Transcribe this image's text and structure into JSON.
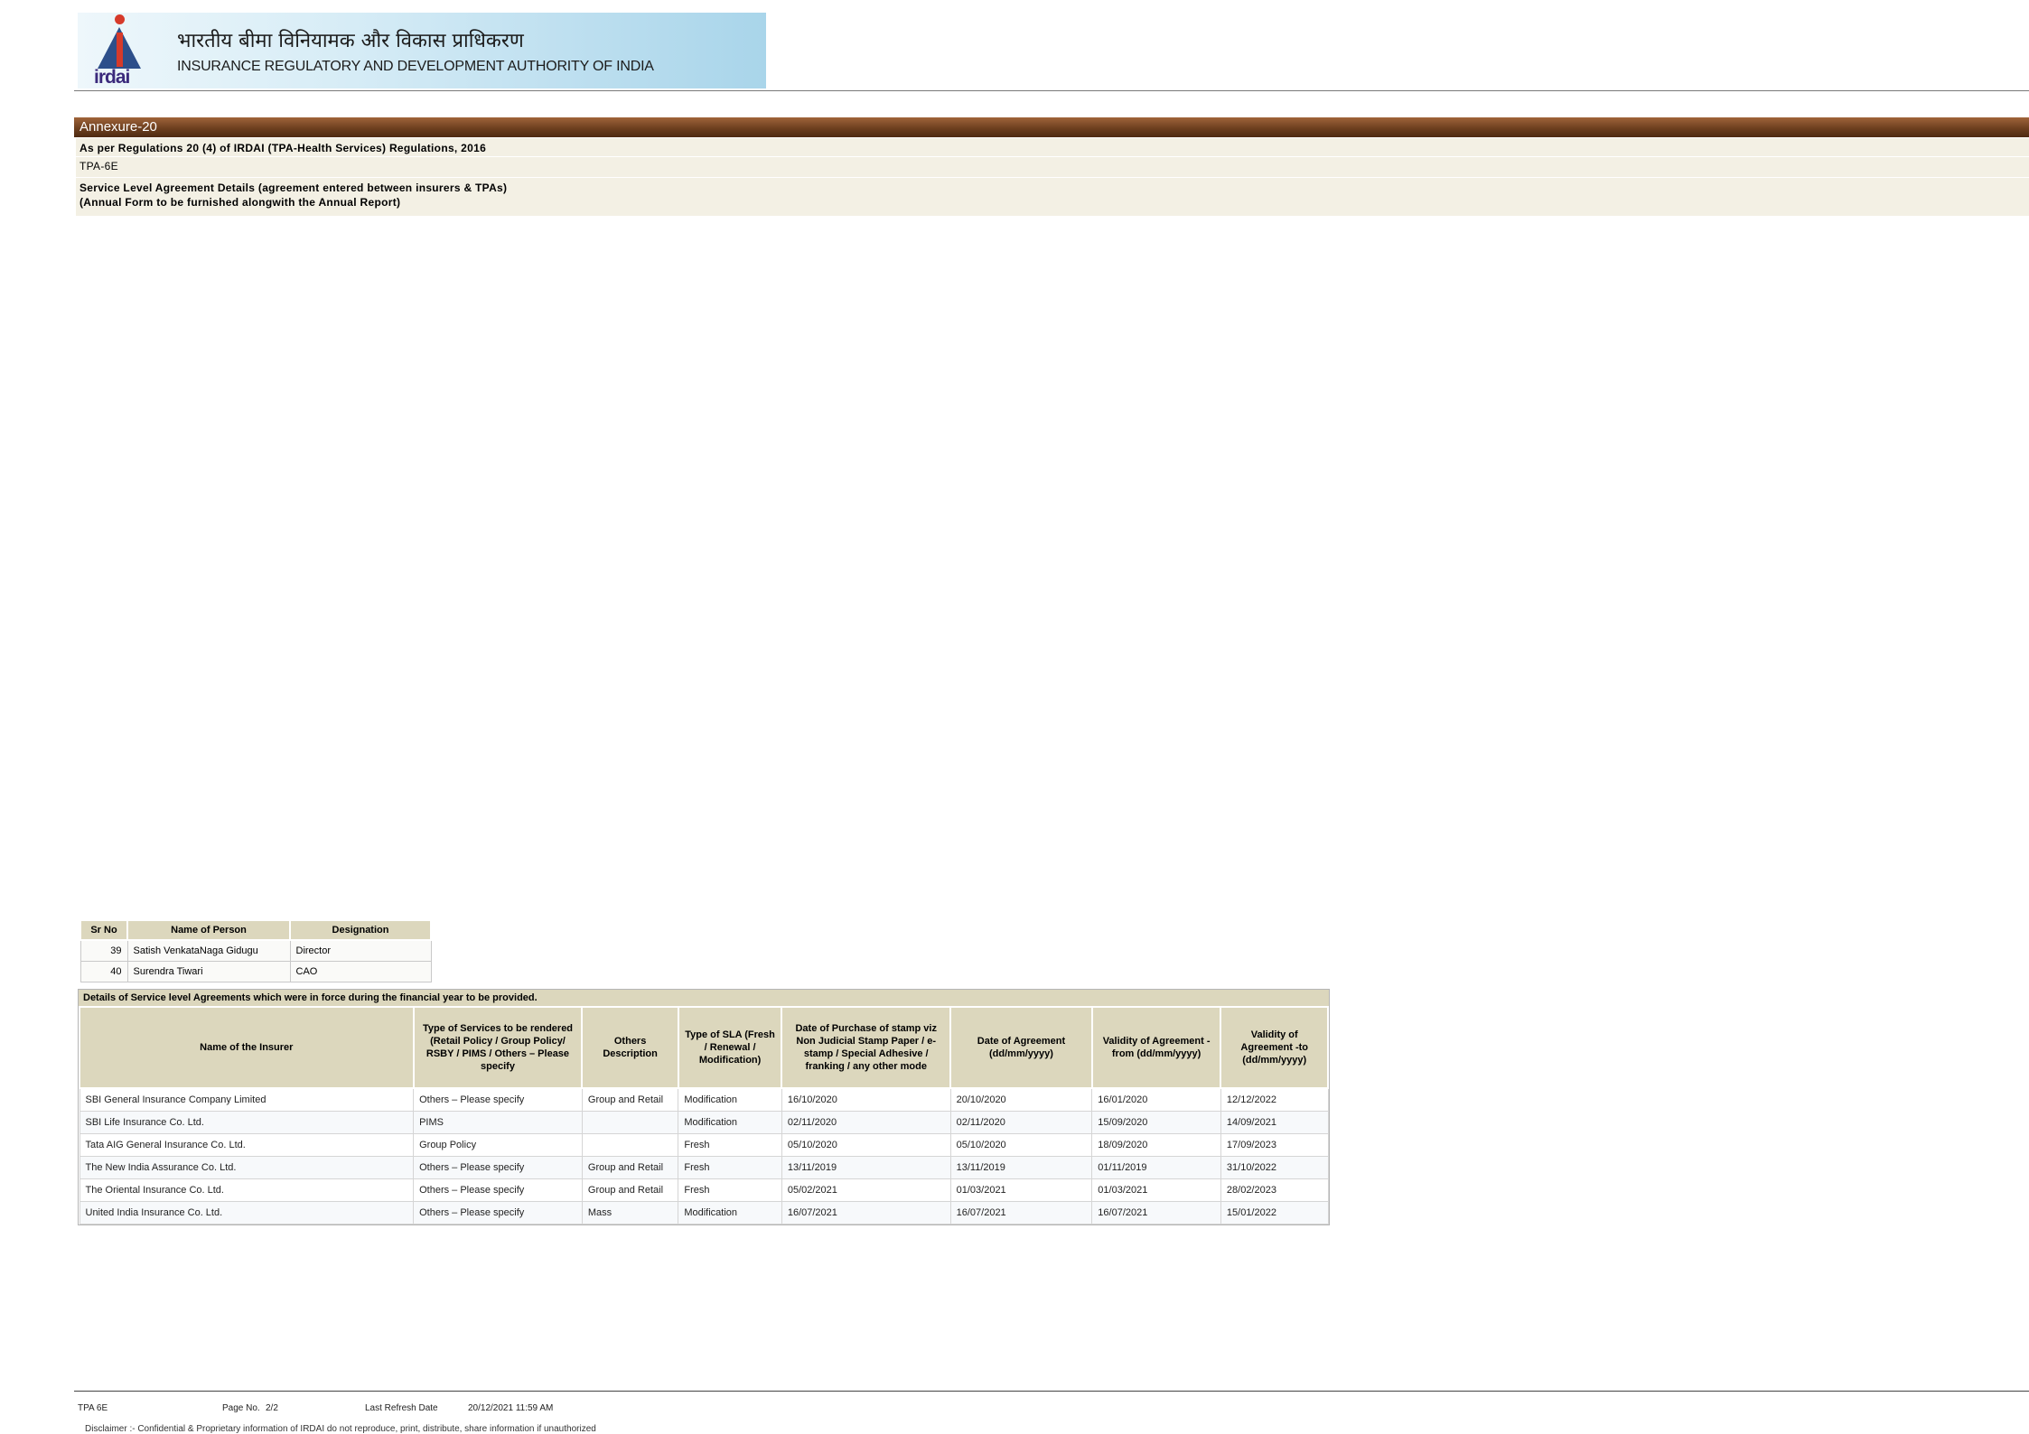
{
  "header": {
    "hindi_title": "भारतीय बीमा विनियामक और विकास प्राधिकरण",
    "english_title": "INSURANCE REGULATORY AND DEVELOPMENT AUTHORITY OF INDIA",
    "logo_text": "irdai"
  },
  "annexure": {
    "title": "Annexure-20",
    "regulation": "As per Regulations 20 (4) of IRDAI (TPA-Health Services) Regulations, 2016",
    "form": "TPA-6E",
    "sla_heading": "Service Level Agreement Details (agreement entered between insurers & TPAs)",
    "annual_note": "(Annual Form to be furnished alongwith the Annual Report)"
  },
  "persons": {
    "headers": [
      "Sr No",
      "Name of Person",
      "Designation"
    ],
    "rows": [
      {
        "sr": "39",
        "name": "Satish VenkataNaga Gidugu",
        "designation": "Director"
      },
      {
        "sr": "40",
        "name": "Surendra Tiwari",
        "designation": "CAO"
      }
    ]
  },
  "sla": {
    "caption": "Details of Service level Agreements which were in force during the financial year to be provided.",
    "headers": [
      "Name of the Insurer",
      "Type of Services to be rendered (Retail Policy / Group Policy/ RSBY / PIMS / Others – Please specify",
      "Others Description",
      "Type of SLA (Fresh / Renewal / Modification)",
      "Date of Purchase of stamp viz Non Judicial Stamp Paper / e-stamp / Special Adhesive / franking / any other mode",
      "Date of Agreement (dd/mm/yyyy)",
      "Validity of Agreement -from (dd/mm/yyyy)",
      "Validity of Agreement -to (dd/mm/yyyy)"
    ],
    "rows": [
      [
        "SBI General Insurance Company Limited",
        "Others – Please specify",
        "Group and Retail",
        "Modification",
        "16/10/2020",
        "20/10/2020",
        "16/01/2020",
        "12/12/2022"
      ],
      [
        "SBI Life Insurance Co. Ltd.",
        "PIMS",
        "",
        "Modification",
        "02/11/2020",
        "02/11/2020",
        "15/09/2020",
        "14/09/2021"
      ],
      [
        "Tata AIG General Insurance Co. Ltd.",
        "Group Policy",
        "",
        "Fresh",
        "05/10/2020",
        "05/10/2020",
        "18/09/2020",
        "17/09/2023"
      ],
      [
        "The New India Assurance Co. Ltd.",
        "Others – Please specify",
        "Group and Retail",
        "Fresh",
        "13/11/2019",
        "13/11/2019",
        "01/11/2019",
        "31/10/2022"
      ],
      [
        "The Oriental Insurance Co. Ltd.",
        "Others – Please specify",
        "Group and Retail",
        "Fresh",
        "05/02/2021",
        "01/03/2021",
        "01/03/2021",
        "28/02/2023"
      ],
      [
        "United India Insurance Co. Ltd.",
        "Others – Please specify",
        "Mass",
        "Modification",
        "16/07/2021",
        "16/07/2021",
        "16/07/2021",
        "15/01/2022"
      ]
    ]
  },
  "footer": {
    "form": "TPA 6E",
    "page_label": "Page No.",
    "page_value": "2/2",
    "refresh_label": "Last Refresh Date",
    "refresh_value": "20/12/2021 11:59 AM",
    "disclaimer": "Disclaimer :- Confidential & Proprietary information of IRDAI do not reproduce, print, distribute, share information if unauthorized"
  }
}
